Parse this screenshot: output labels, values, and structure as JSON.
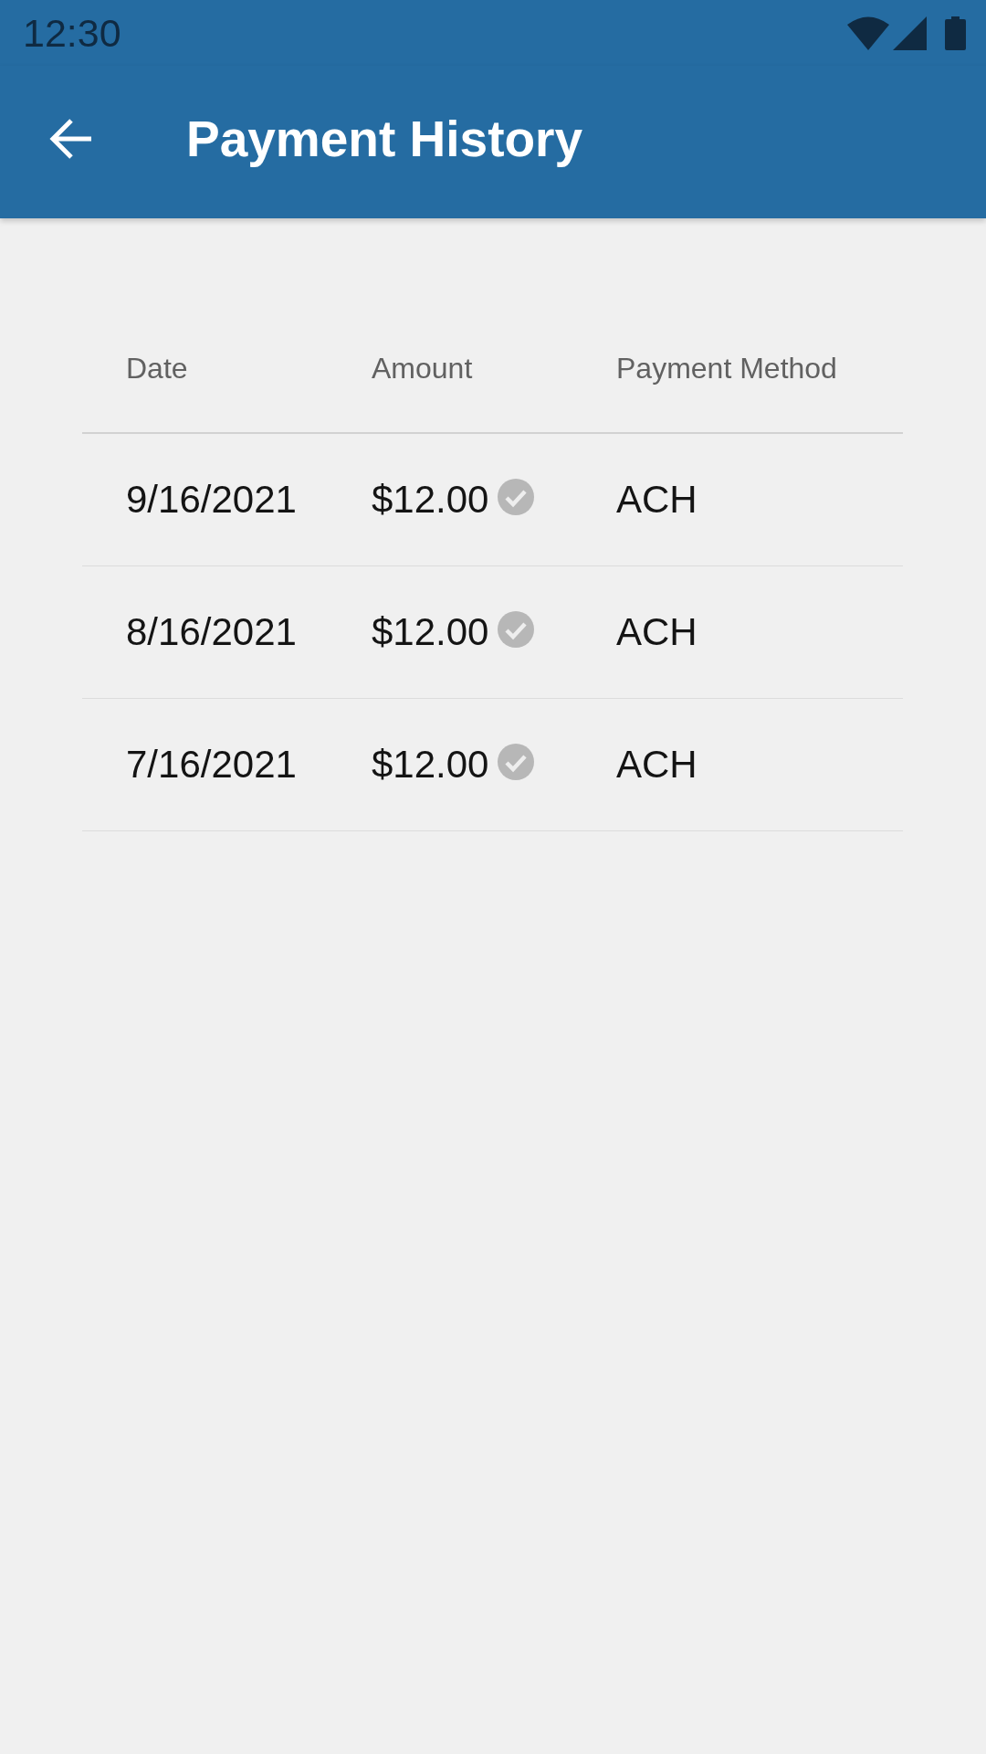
{
  "status_bar": {
    "time": "12:30"
  },
  "app_bar": {
    "title": "Payment History"
  },
  "table": {
    "columns": [
      "Date",
      "Amount",
      "Payment Method"
    ],
    "rows": [
      {
        "date": "9/16/2021",
        "amount": "$12.00",
        "confirmed": true,
        "method": "ACH"
      },
      {
        "date": "8/16/2021",
        "amount": "$12.00",
        "confirmed": true,
        "method": "ACH"
      },
      {
        "date": "7/16/2021",
        "amount": "$12.00",
        "confirmed": true,
        "method": "ACH"
      }
    ]
  }
}
